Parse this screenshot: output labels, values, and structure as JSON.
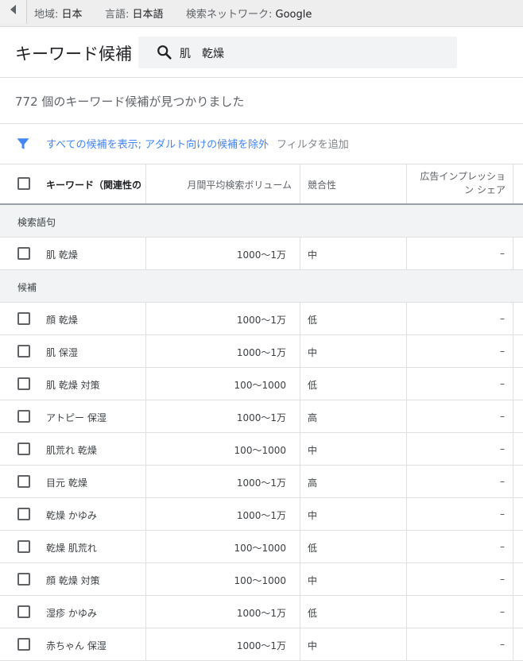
{
  "topbar": {
    "region_label": "地域:",
    "region_value": "日本",
    "language_label": "言語:",
    "language_value": "日本語",
    "network_label": "検索ネットワーク:",
    "network_value": "Google"
  },
  "header": {
    "title": "キーワード候補",
    "search_query": "肌　乾燥"
  },
  "result_count": "772 個のキーワード候補が見つかりました",
  "filter": {
    "active": "すべての候補を表示; アダルト向けの候補を除外",
    "add": "フィルタを追加"
  },
  "columns": {
    "keyword": "キーワード（関連性の",
    "volume": "月間平均検索ボリューム",
    "competition": "競合性",
    "impression_share": "広告インプレッション シェア"
  },
  "sections": {
    "search_terms": "検索語句",
    "suggestions": "候補"
  },
  "search_term_rows": [
    {
      "keyword": "肌 乾燥",
      "volume": "1000〜1万",
      "competition": "中",
      "share": "–"
    }
  ],
  "suggestion_rows": [
    {
      "keyword": "顔 乾燥",
      "volume": "1000〜1万",
      "competition": "低",
      "share": "–"
    },
    {
      "keyword": "肌 保湿",
      "volume": "1000〜1万",
      "competition": "中",
      "share": "–"
    },
    {
      "keyword": "肌 乾燥 対策",
      "volume": "100〜1000",
      "competition": "低",
      "share": "–"
    },
    {
      "keyword": "アトピー 保湿",
      "volume": "1000〜1万",
      "competition": "高",
      "share": "–"
    },
    {
      "keyword": "肌荒れ 乾燥",
      "volume": "100〜1000",
      "competition": "中",
      "share": "–"
    },
    {
      "keyword": "目元 乾燥",
      "volume": "1000〜1万",
      "competition": "高",
      "share": "–"
    },
    {
      "keyword": "乾燥 かゆみ",
      "volume": "1000〜1万",
      "competition": "中",
      "share": "–"
    },
    {
      "keyword": "乾燥 肌荒れ",
      "volume": "100〜1000",
      "competition": "低",
      "share": "–"
    },
    {
      "keyword": "顔 乾燥 対策",
      "volume": "100〜1000",
      "competition": "中",
      "share": "–"
    },
    {
      "keyword": "湿疹 かゆみ",
      "volume": "1000〜1万",
      "competition": "低",
      "share": "–"
    },
    {
      "keyword": "赤ちゃん 保湿",
      "volume": "1000〜1万",
      "competition": "中",
      "share": "–"
    }
  ],
  "colors": {
    "accent": "#4285f4",
    "section_bg": "#f1f3f4",
    "topbar_bg": "#eeeeee"
  },
  "icons": [
    "back-arrow-icon",
    "search-icon",
    "filter-icon"
  ]
}
